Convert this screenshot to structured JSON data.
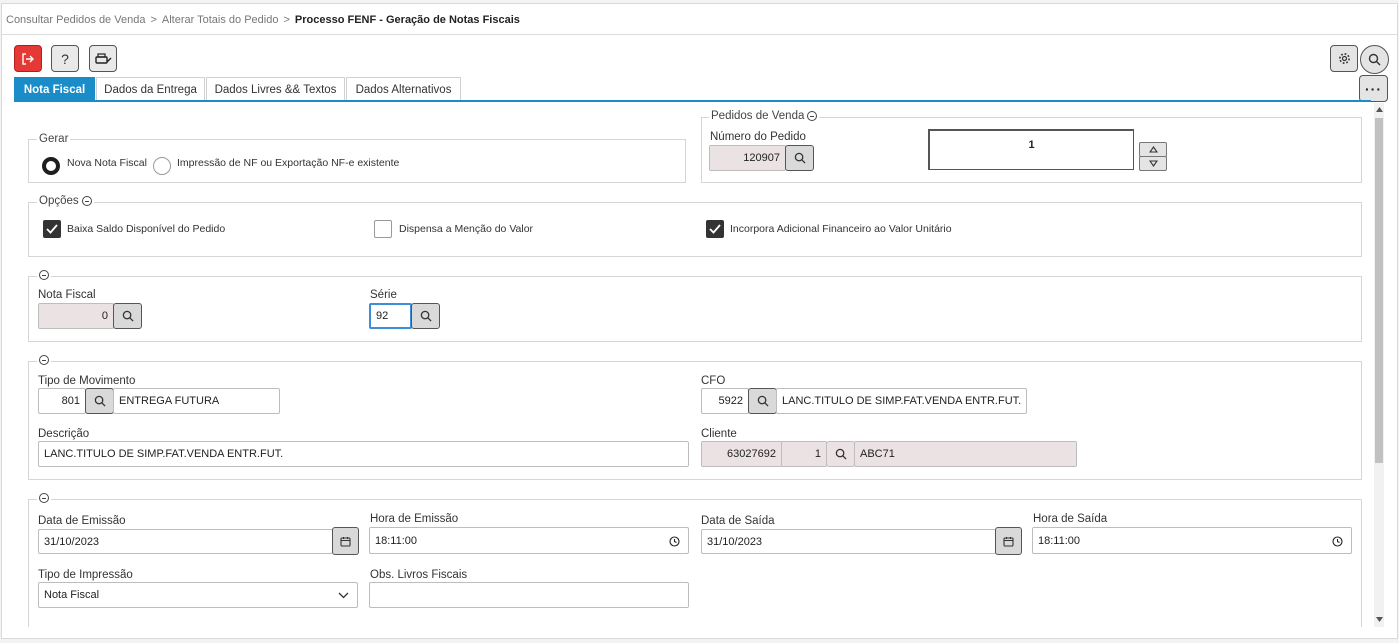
{
  "breadcrumb": {
    "item1": "Consultar Pedidos de Venda",
    "item2": "Alterar Totais do Pedido",
    "current": "Processo FENF - Geração de Notas Fiscais",
    "separator": ">"
  },
  "tabs": [
    "Nota Fiscal",
    "Dados da Entrega",
    "Dados Livres && Textos",
    "Dados Alternativos"
  ],
  "gerar": {
    "legend": "Gerar",
    "option1": "Nova Nota Fiscal",
    "option2": "Impressão de NF ou Exportação NF-e existente"
  },
  "pedidos": {
    "legend": "Pedidos de Venda",
    "numero_label": "Número do Pedido",
    "numero_value": "120907",
    "count": "1"
  },
  "opcoes": {
    "legend": "Opções",
    "baixa": "Baixa Saldo Disponível do Pedido",
    "dispensa": "Dispensa a Menção do Valor",
    "incorpora": "Incorpora Adicional Financeiro ao Valor Unitário"
  },
  "nota": {
    "nf_label": "Nota Fiscal",
    "nf_value": "0",
    "serie_label": "Série",
    "serie_value": "92"
  },
  "movimento": {
    "tipo_label": "Tipo de Movimento",
    "tipo_code": "801",
    "tipo_desc": "ENTREGA FUTURA",
    "cfo_label": "CFO",
    "cfo_code": "5922",
    "cfo_desc": "LANC.TITULO DE SIMP.FAT.VENDA ENTR.FUT.",
    "descricao_label": "Descrição",
    "descricao_value": "LANC.TITULO DE SIMP.FAT.VENDA ENTR.FUT.",
    "cliente_label": "Cliente",
    "cliente_code": "63027692",
    "cliente_seq": "1",
    "cliente_name": "ABC71"
  },
  "datas": {
    "emissao_label": "Data de Emissão",
    "emissao_value": "31/10/2023",
    "hora_emissao_label": "Hora de Emissão",
    "hora_emissao_value": "18:11:00",
    "saida_label": "Data de Saída",
    "saida_value": "31/10/2023",
    "hora_saida_label": "Hora de Saída",
    "hora_saida_value": "18:11:00",
    "tipo_impressao_label": "Tipo de Impressão",
    "tipo_impressao_value": "Nota Fiscal",
    "obs_label": "Obs. Livros Fiscais",
    "obs_value": ""
  },
  "colors": {
    "accent": "#1a8cc8",
    "exit": "#e53935",
    "readonly": "#ebe3e3"
  }
}
